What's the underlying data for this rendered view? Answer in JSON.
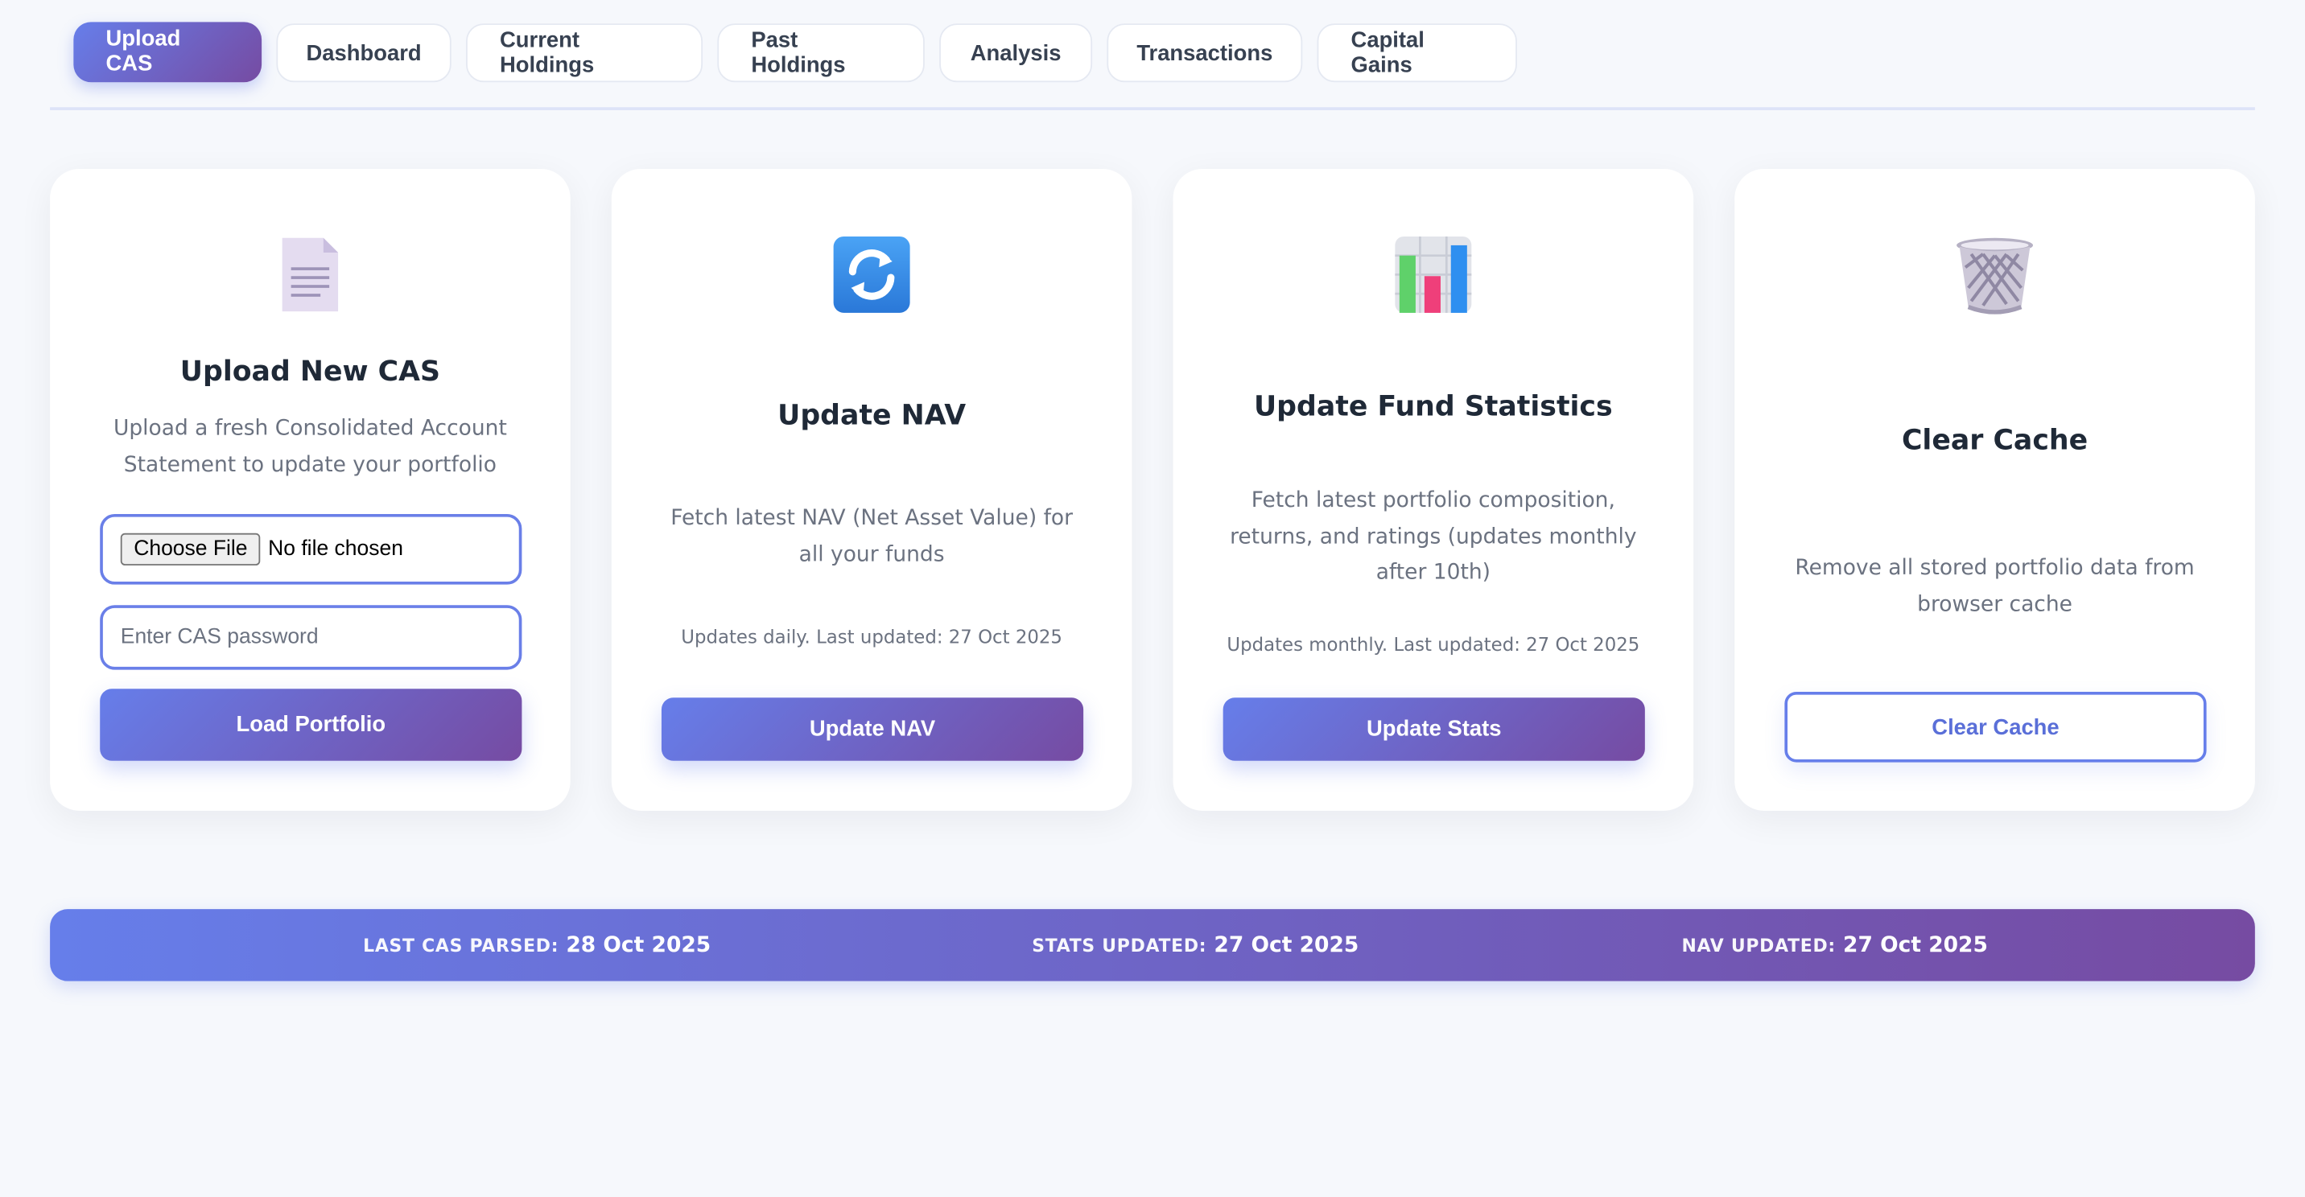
{
  "tabs": [
    {
      "label": "Upload CAS",
      "active": true
    },
    {
      "label": "Dashboard"
    },
    {
      "label": "Current Holdings"
    },
    {
      "label": "Past Holdings"
    },
    {
      "label": "Analysis"
    },
    {
      "label": "Transactions"
    },
    {
      "label": "Capital Gains"
    }
  ],
  "colors": {
    "accent_start": "#667eea",
    "accent_end": "#764ba2",
    "background": "#f6f8fc"
  },
  "cards": {
    "upload": {
      "icon": "document-icon",
      "title": "Upload New CAS",
      "description": "Upload a fresh Consolidated Account Statement to update your portfolio",
      "file_button": "Choose File",
      "file_status": "No file chosen",
      "password_placeholder": "Enter CAS password",
      "password_value": "",
      "button": "Load Portfolio"
    },
    "nav": {
      "icon": "refresh-icon",
      "title": "Update NAV",
      "description": "Fetch latest NAV (Net Asset Value) for all your funds",
      "note": "Updates daily. Last updated: 27 Oct 2025",
      "button": "Update NAV"
    },
    "stats": {
      "icon": "bar-chart-icon",
      "title": "Update Fund Statistics",
      "description": "Fetch latest portfolio composition, returns, and ratings (updates monthly after 10th)",
      "note": "Updates monthly. Last updated: 27 Oct 2025",
      "button": "Update Stats"
    },
    "cache": {
      "icon": "wastebasket-icon",
      "title": "Clear Cache",
      "description": "Remove all stored portfolio data from browser cache",
      "button": "Clear Cache"
    }
  },
  "status_bar": {
    "cas_label": "Last CAS Parsed:",
    "cas_value": "28 Oct 2025",
    "stats_label": "Stats Updated:",
    "stats_value": "27 Oct 2025",
    "nav_label": "NAV Updated:",
    "nav_value": "27 Oct 2025"
  }
}
